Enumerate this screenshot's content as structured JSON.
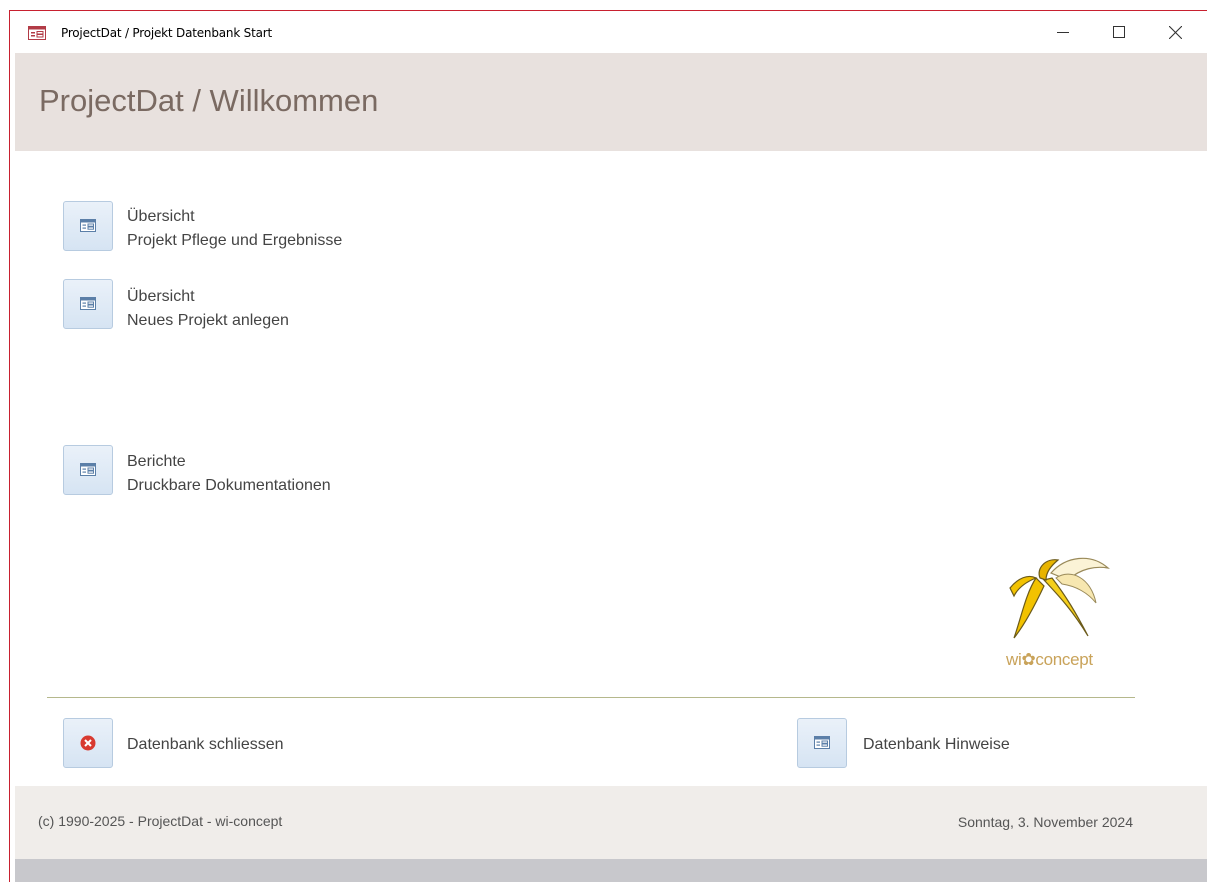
{
  "window": {
    "title": "ProjectDat / Projekt Datenbank Start",
    "controls": [
      "minimize-icon",
      "maximize-icon",
      "close-icon"
    ]
  },
  "header": {
    "title": "ProjectDat / Willkommen"
  },
  "nav": [
    {
      "line1": "Übersicht",
      "line2": "Projekt Pflege und Ergebnisse",
      "icon": "form-icon"
    },
    {
      "line1": "Übersicht",
      "line2": "Neues Projekt anlegen",
      "icon": "form-icon"
    },
    {
      "line1": "Berichte",
      "line2": "Druckbare Dokumentationen",
      "icon": "form-icon"
    }
  ],
  "actions": {
    "close_db": {
      "label": "Datenbank schliessen",
      "icon": "close-circle-icon"
    },
    "hints": {
      "label": "Datenbank Hinweise",
      "icon": "form-icon"
    }
  },
  "logo": {
    "text": "wi✿concept"
  },
  "footer": {
    "copyright": "(c) 1990-2025 - ProjectDat - wi-concept",
    "date": "Sonntag, 3. November 2024"
  },
  "colors": {
    "header_band": "#e8e1de",
    "header_text": "#7a6a62",
    "button_fill": "#dce7f4",
    "close_red": "#d83a30",
    "logo_yellow": "#f2c200",
    "logo_text": "#c9a35a"
  }
}
